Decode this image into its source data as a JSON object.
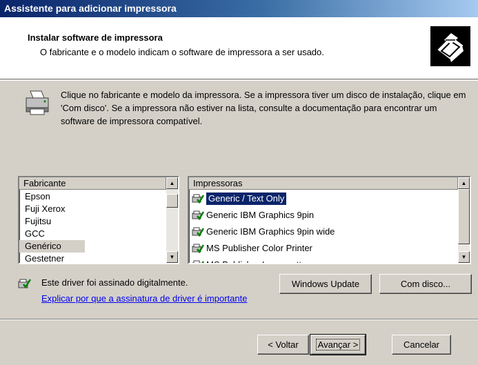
{
  "window": {
    "title": "Assistente para adicionar impressora"
  },
  "header": {
    "title": "Instalar software de impressora",
    "subtitle": "O fabricante e o modelo indicam o software de impressora a ser usado."
  },
  "instructions": "Clique no fabricante e modelo da impressora. Se a impressora tiver um disco de instalação, clique em 'Com disco'. Se a impressora não estiver na lista, consulte a documentação para encontrar um software de impressora compatível.",
  "manufacturers": {
    "header": "Fabricante",
    "items": [
      "Epson",
      "Fuji Xerox",
      "Fujitsu",
      "GCC",
      "Genérico",
      "Gestetner"
    ],
    "selected": "Genérico"
  },
  "printers": {
    "header": "Impressoras",
    "items": [
      "Generic / Text Only",
      "Generic IBM Graphics 9pin",
      "Generic IBM Graphics 9pin wide",
      "MS Publisher Color Printer",
      "MS Publisher Imagesetter"
    ],
    "selected": "Generic / Text Only"
  },
  "signature": {
    "text": "Este driver foi assinado digitalmente.",
    "link": "Explicar por que a assinatura de driver é importante"
  },
  "buttons": {
    "windows_update": "Windows Update",
    "have_disk": "Com disco...",
    "back": "< Voltar",
    "next": "Avançar >",
    "cancel": "Cancelar"
  },
  "colors": {
    "selection": "#0a246a",
    "link": "#0000ee",
    "dialog": "#d4d0c8"
  }
}
